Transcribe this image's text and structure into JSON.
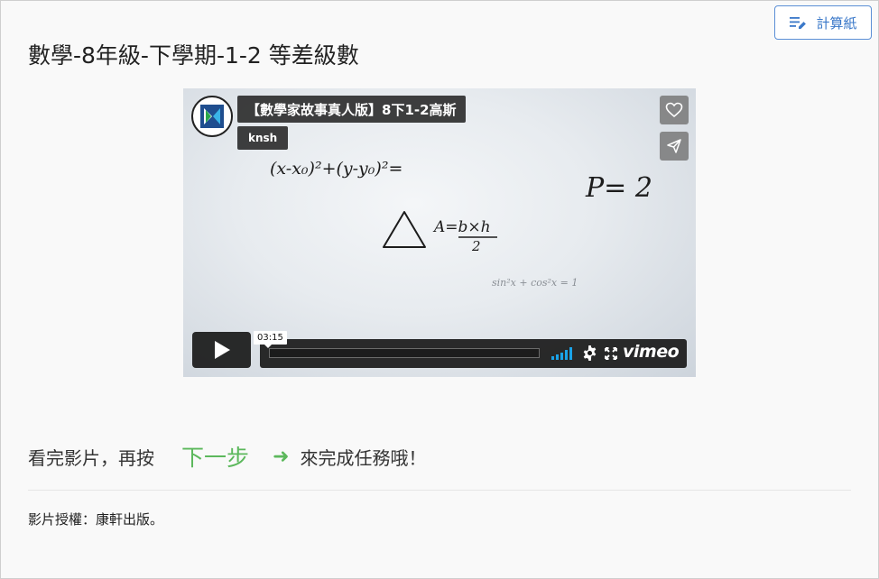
{
  "toolbar": {
    "calculator_label": "計算紙",
    "calculator_icon": "edit-list-icon"
  },
  "page": {
    "title": "數學-8年級-下學期-1-2 等差級數"
  },
  "video": {
    "title": "【數學家故事真人版】8下1-2高斯",
    "author": "knsh",
    "timecode": "03:15",
    "brand": "vimeo",
    "side_buttons": [
      "heart-icon",
      "share-icon"
    ],
    "controls": [
      "play-icon",
      "volume-icon",
      "settings-icon",
      "fullscreen-icon"
    ],
    "board_text": {
      "formula_circle": "(x-x₀)²+(y-y₀)²=",
      "formula_triangle_num": "A=b×h",
      "formula_triangle_den": "2",
      "formula_trig": "sin²x + cos²x = 1",
      "formula_p": "P= 2"
    }
  },
  "instruction": {
    "before": "看完影片，再按",
    "next_step": "下一步",
    "arrow": "➜",
    "after": "來完成任務哦！"
  },
  "license": {
    "text": "影片授權：康軒出版。"
  },
  "colors": {
    "accent_blue": "#3a78c9",
    "next_green": "#5cb85c",
    "video_overlay": "#1e1e1e"
  }
}
